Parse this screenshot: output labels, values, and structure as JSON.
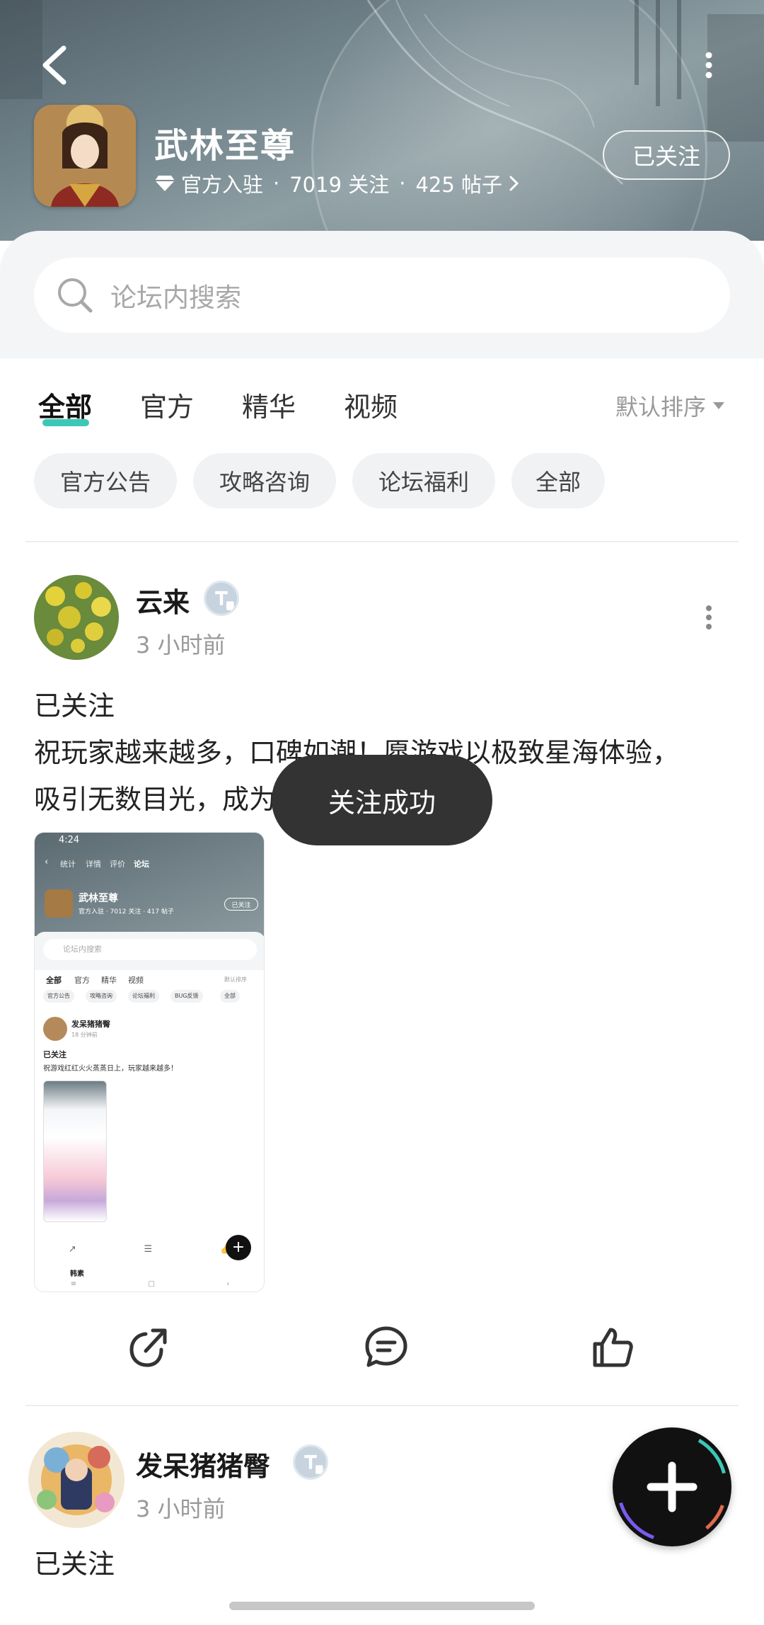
{
  "header": {
    "title": "武林至尊",
    "meta_official": "官方入驻",
    "meta_followers": "7019 关注",
    "meta_posts": "425 帖子",
    "follow_label": "已关注"
  },
  "search": {
    "placeholder": "论坛内搜索"
  },
  "tabs": [
    {
      "label": "全部",
      "active": true
    },
    {
      "label": "官方",
      "active": false
    },
    {
      "label": "精华",
      "active": false
    },
    {
      "label": "视频",
      "active": false
    }
  ],
  "sort_label": "默认排序",
  "chips": [
    "官方公告",
    "攻略咨询",
    "论坛福利",
    "全部"
  ],
  "posts": [
    {
      "username": "云来",
      "time": "3 小时前",
      "tag": "已关注",
      "body_line1": "祝玩家越来越多，口碑如潮！愿游戏以极致星海体验，",
      "body_line2": "吸引无数目光，成为手游经典！",
      "screenshot": {
        "status_time": "4:24",
        "tabs": [
          "统计",
          "详情",
          "评价",
          "论坛"
        ],
        "title": "武林至尊",
        "follow": "已关注",
        "meta": "官方入驻 · 7012 关注 · 417 帖子",
        "search": "论坛内搜索",
        "main_tabs": [
          "全部",
          "官方",
          "精华",
          "视频"
        ],
        "sort": "默认排序",
        "chips": [
          "官方公告",
          "攻略咨询",
          "论坛福利",
          "BUG反馈",
          "全部"
        ],
        "post_user": "发呆猪猪臀",
        "post_time": "18 分钟前",
        "post_tag": "已关注",
        "post_text": "祝游戏红红火火蒸蒸日上，玩家越来越多！",
        "next_user": "韩素"
      }
    },
    {
      "username": "发呆猪猪臀",
      "time": "3 小时前",
      "tag": "已关注"
    }
  ],
  "toast": "关注成功",
  "colors": {
    "accent": "#3cc8b6",
    "toast_bg": "#333333",
    "fab_bg": "#111111"
  }
}
